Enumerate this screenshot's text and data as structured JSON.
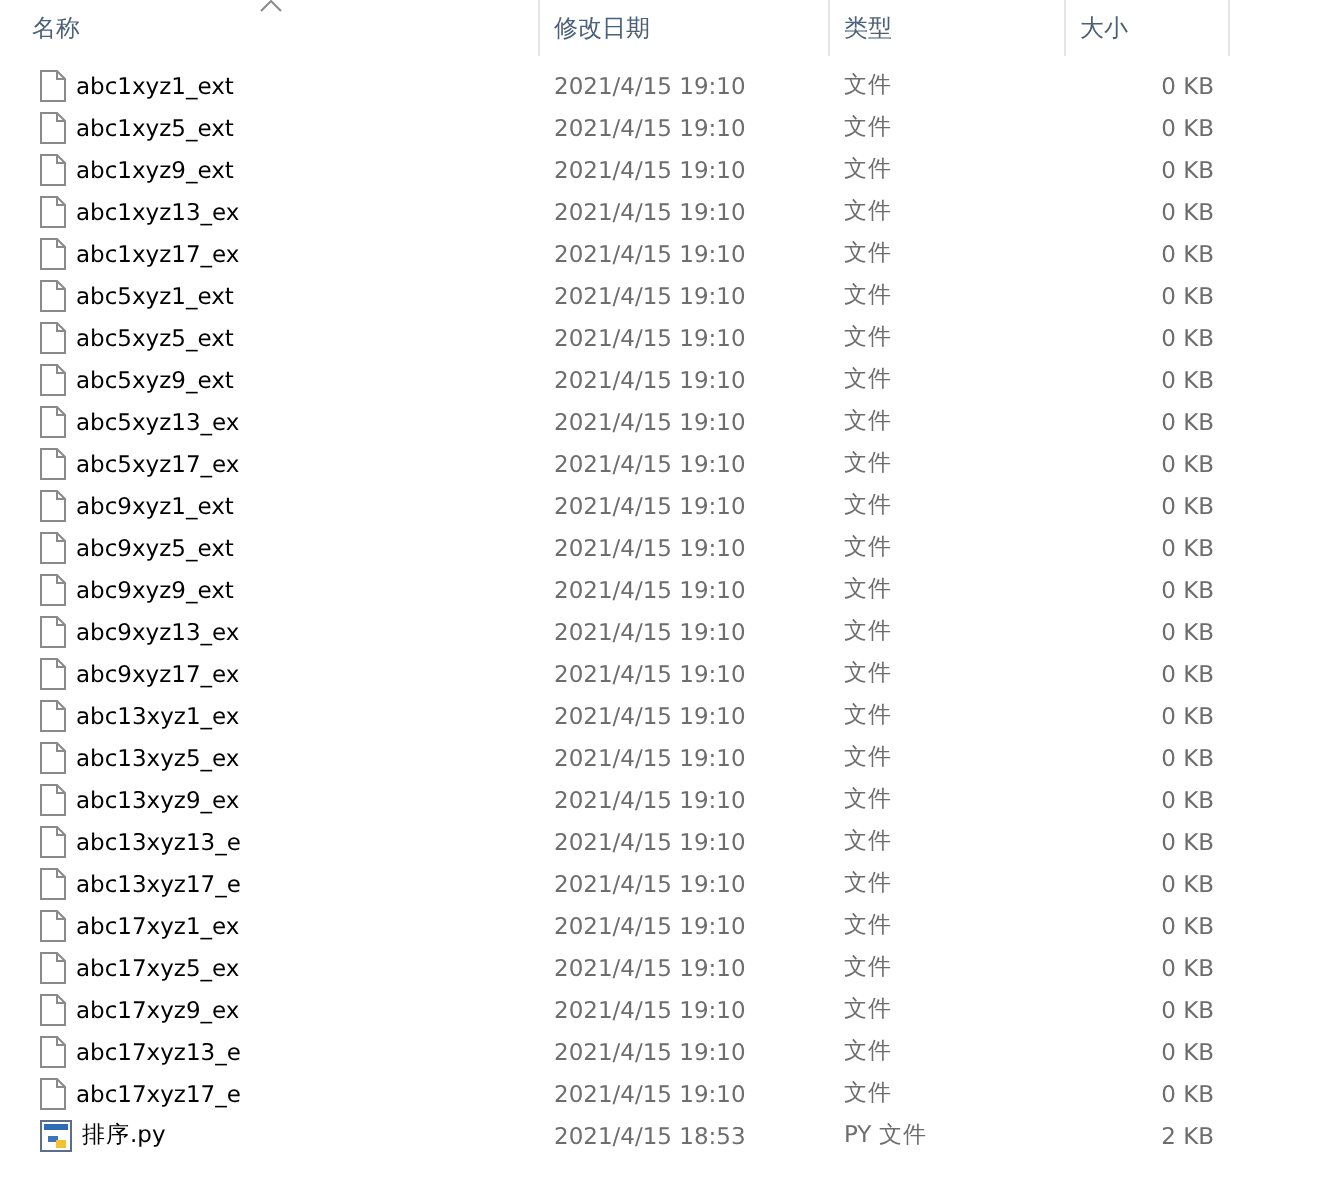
{
  "columns": [
    {
      "label": "名称",
      "sorted": true
    },
    {
      "label": "修改日期",
      "sorted": false
    },
    {
      "label": "类型",
      "sorted": false
    },
    {
      "label": "大小",
      "sorted": false
    }
  ],
  "files": [
    {
      "kind": "file",
      "name": "abc1xyz1_ext",
      "modified": "2021/4/15 19:10",
      "type": "文件",
      "size": "0 KB"
    },
    {
      "kind": "file",
      "name": "abc1xyz5_ext",
      "modified": "2021/4/15 19:10",
      "type": "文件",
      "size": "0 KB"
    },
    {
      "kind": "file",
      "name": "abc1xyz9_ext",
      "modified": "2021/4/15 19:10",
      "type": "文件",
      "size": "0 KB"
    },
    {
      "kind": "file",
      "name": "abc1xyz13_ex",
      "modified": "2021/4/15 19:10",
      "type": "文件",
      "size": "0 KB"
    },
    {
      "kind": "file",
      "name": "abc1xyz17_ex",
      "modified": "2021/4/15 19:10",
      "type": "文件",
      "size": "0 KB"
    },
    {
      "kind": "file",
      "name": "abc5xyz1_ext",
      "modified": "2021/4/15 19:10",
      "type": "文件",
      "size": "0 KB"
    },
    {
      "kind": "file",
      "name": "abc5xyz5_ext",
      "modified": "2021/4/15 19:10",
      "type": "文件",
      "size": "0 KB"
    },
    {
      "kind": "file",
      "name": "abc5xyz9_ext",
      "modified": "2021/4/15 19:10",
      "type": "文件",
      "size": "0 KB"
    },
    {
      "kind": "file",
      "name": "abc5xyz13_ex",
      "modified": "2021/4/15 19:10",
      "type": "文件",
      "size": "0 KB"
    },
    {
      "kind": "file",
      "name": "abc5xyz17_ex",
      "modified": "2021/4/15 19:10",
      "type": "文件",
      "size": "0 KB"
    },
    {
      "kind": "file",
      "name": "abc9xyz1_ext",
      "modified": "2021/4/15 19:10",
      "type": "文件",
      "size": "0 KB"
    },
    {
      "kind": "file",
      "name": "abc9xyz5_ext",
      "modified": "2021/4/15 19:10",
      "type": "文件",
      "size": "0 KB"
    },
    {
      "kind": "file",
      "name": "abc9xyz9_ext",
      "modified": "2021/4/15 19:10",
      "type": "文件",
      "size": "0 KB"
    },
    {
      "kind": "file",
      "name": "abc9xyz13_ex",
      "modified": "2021/4/15 19:10",
      "type": "文件",
      "size": "0 KB"
    },
    {
      "kind": "file",
      "name": "abc9xyz17_ex",
      "modified": "2021/4/15 19:10",
      "type": "文件",
      "size": "0 KB"
    },
    {
      "kind": "file",
      "name": "abc13xyz1_ex",
      "modified": "2021/4/15 19:10",
      "type": "文件",
      "size": "0 KB"
    },
    {
      "kind": "file",
      "name": "abc13xyz5_ex",
      "modified": "2021/4/15 19:10",
      "type": "文件",
      "size": "0 KB"
    },
    {
      "kind": "file",
      "name": "abc13xyz9_ex",
      "modified": "2021/4/15 19:10",
      "type": "文件",
      "size": "0 KB"
    },
    {
      "kind": "file",
      "name": "abc13xyz13_e",
      "modified": "2021/4/15 19:10",
      "type": "文件",
      "size": "0 KB"
    },
    {
      "kind": "file",
      "name": "abc13xyz17_e",
      "modified": "2021/4/15 19:10",
      "type": "文件",
      "size": "0 KB"
    },
    {
      "kind": "file",
      "name": "abc17xyz1_ex",
      "modified": "2021/4/15 19:10",
      "type": "文件",
      "size": "0 KB"
    },
    {
      "kind": "file",
      "name": "abc17xyz5_ex",
      "modified": "2021/4/15 19:10",
      "type": "文件",
      "size": "0 KB"
    },
    {
      "kind": "file",
      "name": "abc17xyz9_ex",
      "modified": "2021/4/15 19:10",
      "type": "文件",
      "size": "0 KB"
    },
    {
      "kind": "file",
      "name": "abc17xyz13_e",
      "modified": "2021/4/15 19:10",
      "type": "文件",
      "size": "0 KB"
    },
    {
      "kind": "file",
      "name": "abc17xyz17_e",
      "modified": "2021/4/15 19:10",
      "type": "文件",
      "size": "0 KB"
    },
    {
      "kind": "python",
      "name": "排序.py",
      "modified": "2021/4/15 18:53",
      "type": "PY 文件",
      "size": "2 KB"
    }
  ]
}
